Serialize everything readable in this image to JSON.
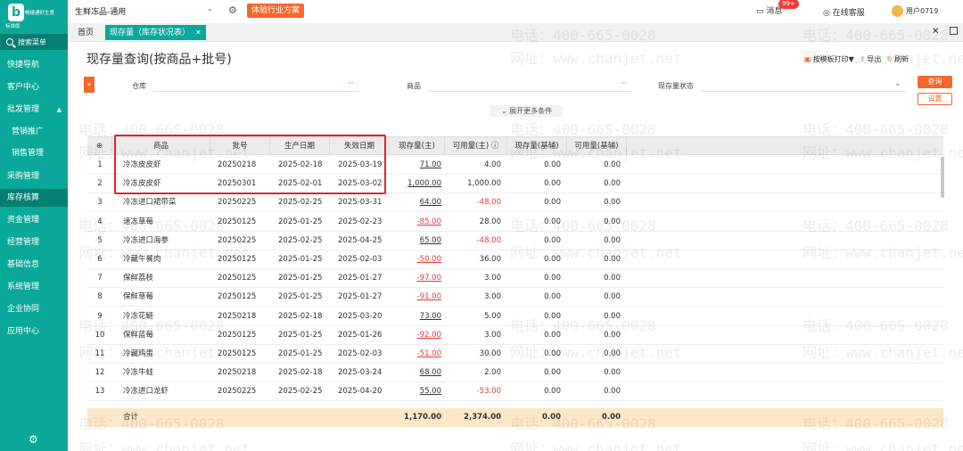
{
  "sidebar": {
    "brand": "畅捷通好生意",
    "edition": "标准版",
    "search_label": "搜索菜单",
    "items": [
      {
        "label": "快捷导航"
      },
      {
        "label": "客户中心"
      },
      {
        "label": "批发管理",
        "caret": "▲"
      },
      {
        "label": "营销推广"
      },
      {
        "label": "销售管理"
      },
      {
        "label": "采购管理"
      },
      {
        "label": "库存核算"
      },
      {
        "label": "资金管理"
      },
      {
        "label": "经营管理"
      },
      {
        "label": "基础信息"
      },
      {
        "label": "系统管理"
      },
      {
        "label": "企业协同"
      },
      {
        "label": "应用中心"
      }
    ]
  },
  "topbar": {
    "store": "生鲜冻品-通用",
    "promo": "体验行业方案",
    "messages_label": "消息",
    "messages_badge": "99+",
    "service_label": "在线客服",
    "user": "用户0719"
  },
  "tabs": {
    "home": "首页",
    "active": "现存量（库存状况表）"
  },
  "page": {
    "title": "现存量查询(按商品+批号)",
    "actions": [
      {
        "icon": "print-icon",
        "label": "按模板打印",
        "caret": "▼"
      },
      {
        "icon": "export-icon",
        "label": "导出"
      },
      {
        "icon": "refresh-icon",
        "label": "刷新"
      }
    ]
  },
  "filters": {
    "warehouse_label": "仓库",
    "product_label": "商品",
    "status_label": "现存量状态",
    "dots": "···",
    "query": "查询",
    "settings": "设置",
    "expand": "展开更多条件"
  },
  "table": {
    "settings_icon": "⊕",
    "columns": [
      "商品",
      "批号",
      "生产日期",
      "失效日期",
      "现存量(主)",
      "可用量(主)",
      "现存量(基辅)",
      "可用量(基辅)"
    ],
    "rows": [
      {
        "no": "1",
        "product": "冷冻皮皮虾",
        "batch": "20250218",
        "prod_date": "2025-02-18",
        "exp_date": "2025-03-19",
        "stock": "71.00",
        "avail": "4.00",
        "stock_aux": "0.00",
        "avail_aux": "0.00"
      },
      {
        "no": "2",
        "product": "冷冻皮皮虾",
        "batch": "20250301",
        "prod_date": "2025-02-01",
        "exp_date": "2025-03-02",
        "stock": "1,000.00",
        "avail": "1,000.00",
        "stock_aux": "0.00",
        "avail_aux": "0.00"
      },
      {
        "no": "3",
        "product": "冷冻进口裙带菜",
        "batch": "20250225",
        "prod_date": "2025-02-25",
        "exp_date": "2025-03-31",
        "stock": "64.00",
        "avail": "-48.00",
        "stock_aux": "0.00",
        "avail_aux": "0.00"
      },
      {
        "no": "4",
        "product": "速冻草莓",
        "batch": "20250125",
        "prod_date": "2025-01-25",
        "exp_date": "2025-02-23",
        "stock": "-85.00",
        "avail": "28.00",
        "stock_aux": "0.00",
        "avail_aux": "0.00"
      },
      {
        "no": "5",
        "product": "冷冻进口海参",
        "batch": "20250225",
        "prod_date": "2025-02-25",
        "exp_date": "2025-04-25",
        "stock": "65.00",
        "avail": "-48.00",
        "stock_aux": "0.00",
        "avail_aux": "0.00"
      },
      {
        "no": "6",
        "product": "冷藏午餐肉",
        "batch": "20250125",
        "prod_date": "2025-01-25",
        "exp_date": "2025-02-03",
        "stock": "-50.00",
        "avail": "36.00",
        "stock_aux": "0.00",
        "avail_aux": "0.00"
      },
      {
        "no": "7",
        "product": "保鲜荔枝",
        "batch": "20250125",
        "prod_date": "2025-01-25",
        "exp_date": "2025-01-27",
        "stock": "-97.00",
        "avail": "3.00",
        "stock_aux": "0.00",
        "avail_aux": "0.00"
      },
      {
        "no": "8",
        "product": "保鲜草莓",
        "batch": "20250125",
        "prod_date": "2025-01-25",
        "exp_date": "2025-01-27",
        "stock": "-91.00",
        "avail": "3.00",
        "stock_aux": "0.00",
        "avail_aux": "0.00"
      },
      {
        "no": "9",
        "product": "冷冻花鲢",
        "batch": "20250218",
        "prod_date": "2025-02-18",
        "exp_date": "2025-03-20",
        "stock": "73.00",
        "avail": "5.00",
        "stock_aux": "0.00",
        "avail_aux": "0.00"
      },
      {
        "no": "10",
        "product": "保鲜蓝莓",
        "batch": "20250125",
        "prod_date": "2025-01-25",
        "exp_date": "2025-01-26",
        "stock": "-92.00",
        "avail": "3.00",
        "stock_aux": "0.00",
        "avail_aux": "0.00"
      },
      {
        "no": "11",
        "product": "冷藏鸡蛋",
        "batch": "20250125",
        "prod_date": "2025-01-25",
        "exp_date": "2025-02-03",
        "stock": "-51.00",
        "avail": "30.00",
        "stock_aux": "0.00",
        "avail_aux": "0.00"
      },
      {
        "no": "12",
        "product": "冷冻牛蛙",
        "batch": "20250218",
        "prod_date": "2025-02-18",
        "exp_date": "2025-03-24",
        "stock": "68.00",
        "avail": "2.00",
        "stock_aux": "0.00",
        "avail_aux": "0.00"
      },
      {
        "no": "13",
        "product": "冷冻进口龙虾",
        "batch": "20250225",
        "prod_date": "2025-02-25",
        "exp_date": "2025-04-20",
        "stock": "55.00",
        "avail": "-53.00",
        "stock_aux": "0.00",
        "avail_aux": "0.00"
      }
    ],
    "total": {
      "label": "合计",
      "stock": "1,170.00",
      "avail": "2,374.00",
      "stock_aux": "0.00",
      "avail_aux": "0.00"
    }
  },
  "watermark": {
    "phone": "电话：400-665-0028",
    "site": "网址：www.chanjet.net"
  },
  "colors": {
    "accent": "#0aa89a",
    "orange": "#f5672a",
    "negative": "#e23b3b",
    "highlight": "#e0242a"
  }
}
